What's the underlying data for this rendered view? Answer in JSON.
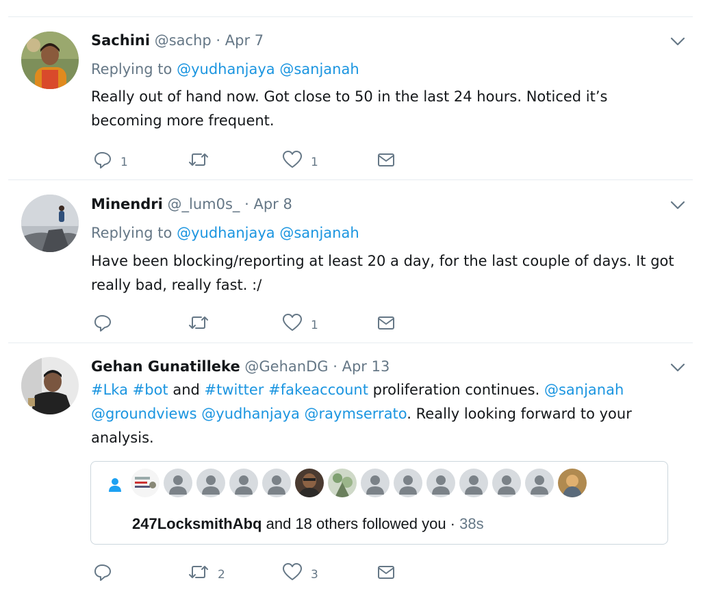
{
  "tweets": [
    {
      "name": "Sachini",
      "handle": "@sachp",
      "dot": "·",
      "date": "Apr 7",
      "replying_prefix": "Replying to",
      "replying_to": [
        "@yudhanjaya",
        "@sanjanah"
      ],
      "text": "Really out of hand now. Got close to 50 in the last 24 hours. Noticed it’s becoming more frequent.",
      "reply_count": "1",
      "retweet_count": "",
      "like_count": "1"
    },
    {
      "name": "Minendri",
      "handle": "@_lum0s_",
      "dot": "·",
      "date": "Apr 8",
      "replying_prefix": "Replying to",
      "replying_to": [
        "@yudhanjaya",
        "@sanjanah"
      ],
      "text": "Have been blocking/reporting at least 20 a day, for the last couple of days. It got really bad, really fast. :/",
      "reply_count": "",
      "retweet_count": "",
      "like_count": "1"
    },
    {
      "name": "Gehan Gunatilleke",
      "handle": "@GehanDG",
      "dot": "·",
      "date": "Apr 13",
      "text_parts": [
        {
          "t": "#Lka",
          "link": true
        },
        {
          "t": " ",
          "link": false
        },
        {
          "t": "#bot",
          "link": true
        },
        {
          "t": " and ",
          "link": false
        },
        {
          "t": "#twitter",
          "link": true
        },
        {
          "t": " ",
          "link": false
        },
        {
          "t": "#fakeaccount",
          "link": true
        },
        {
          "t": " proliferation continues. ",
          "link": false
        },
        {
          "t": "@sanjanah",
          "link": true
        },
        {
          "t": " ",
          "link": false
        },
        {
          "t": "@groundviews",
          "link": true
        },
        {
          "t": " ",
          "link": false
        },
        {
          "t": "@yudhanjaya",
          "link": true
        },
        {
          "t": " ",
          "link": false
        },
        {
          "t": "@raymserrato",
          "link": true
        },
        {
          "t": ". Really looking forward to your analysis.",
          "link": false
        }
      ],
      "card": {
        "account": "247LocksmithAbq",
        "rest": " and 18 others followed you · ",
        "time": "38s"
      },
      "reply_count": "",
      "retweet_count": "2",
      "like_count": "3"
    }
  ],
  "colors": {
    "link": "#1b95e0",
    "muted": "#657786",
    "text": "#14171a",
    "divider": "#e6ecf0"
  },
  "icons": [
    "chevron-down-icon",
    "reply-icon",
    "retweet-icon",
    "like-icon",
    "dm-icon",
    "person-icon"
  ]
}
